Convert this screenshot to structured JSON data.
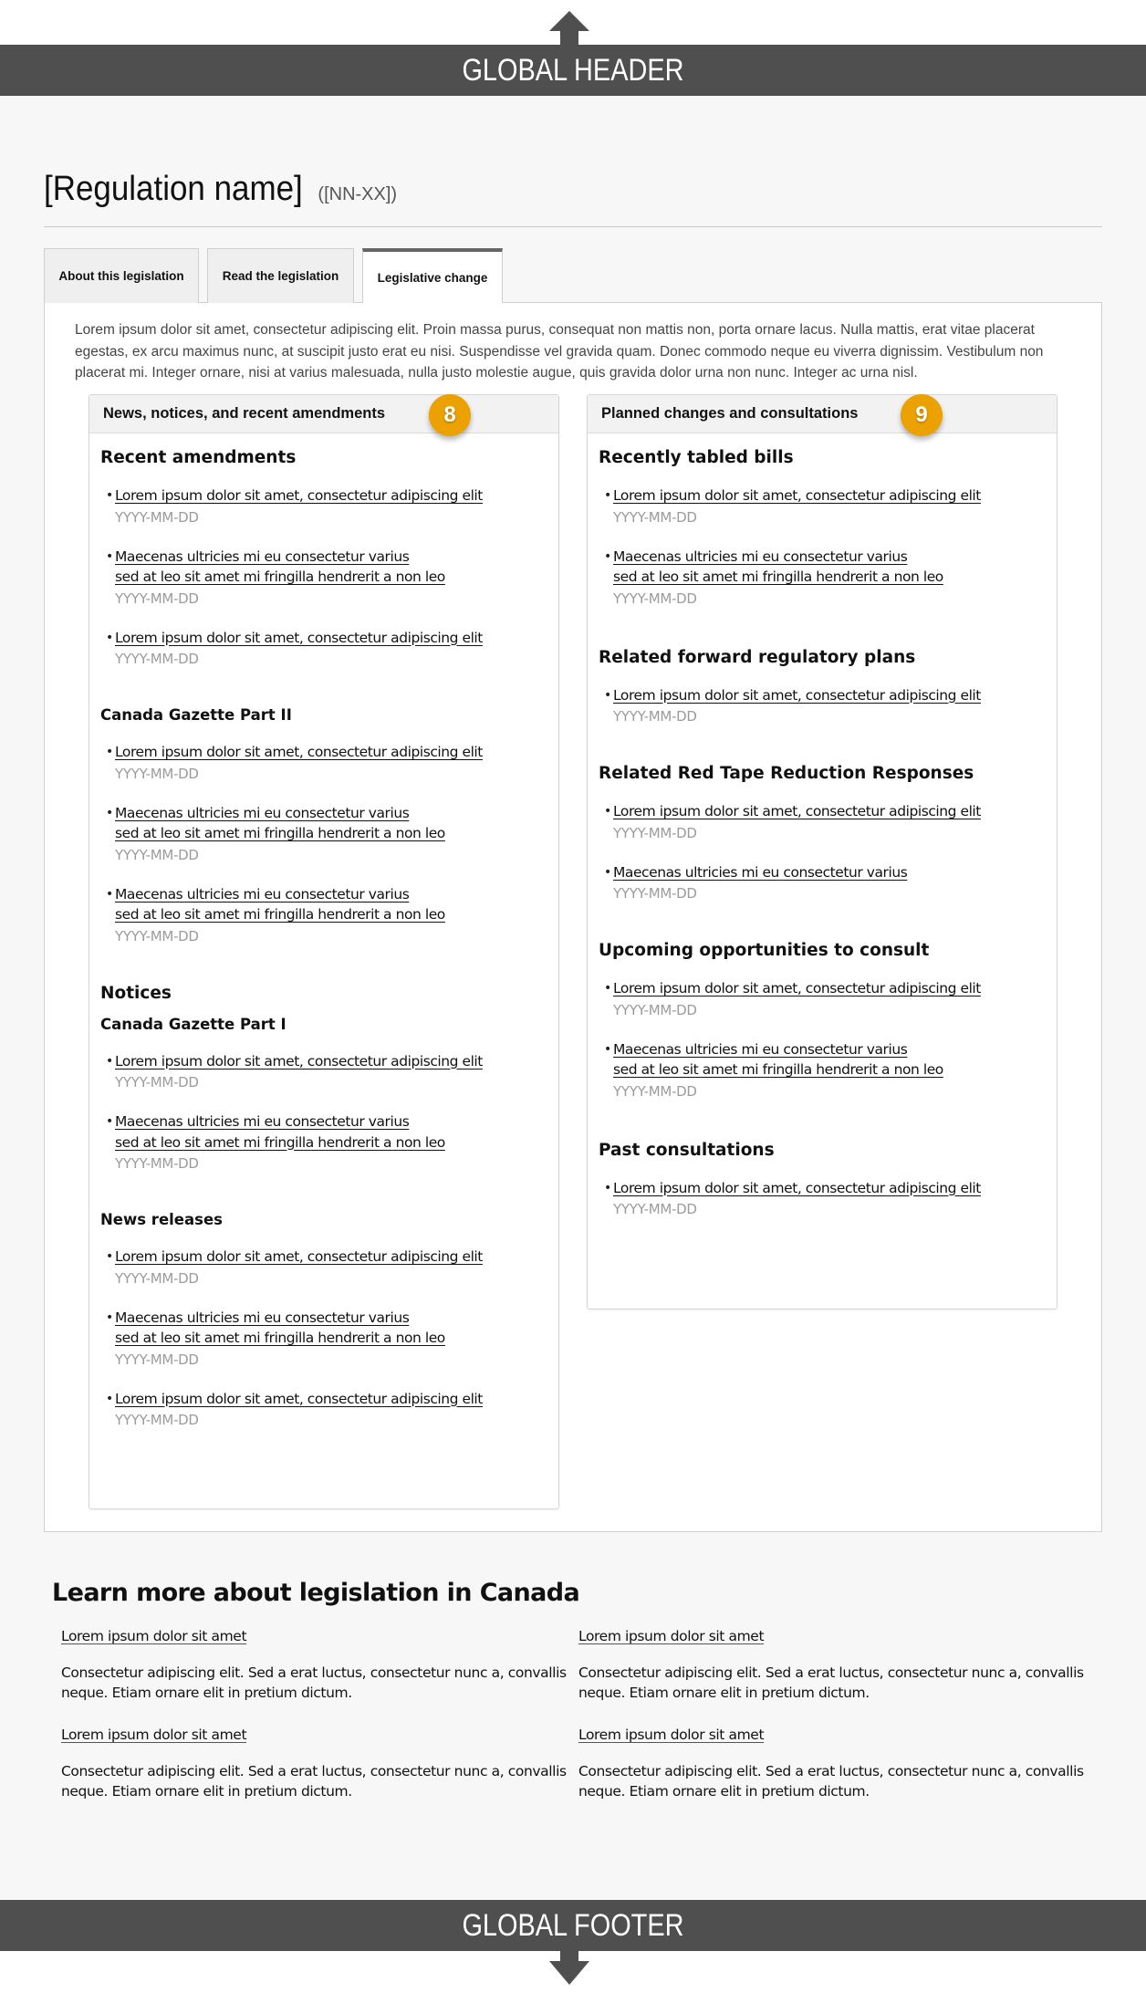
{
  "global_header": {
    "label": "GLOBAL HEADER",
    "arrow": "arrow-up-icon"
  },
  "global_footer": {
    "label": "GLOBAL FOOTER",
    "arrow": "arrow-down-icon"
  },
  "page": {
    "title": "[Regulation name]",
    "code": "([NN-XX])"
  },
  "tabs": [
    {
      "label": "About this legislation",
      "active": false
    },
    {
      "label": "Read the legislation",
      "active": false
    },
    {
      "label": "Legislative change",
      "active": true
    }
  ],
  "intro": "Lorem ipsum dolor sit amet, consectetur adipiscing elit. Proin massa purus, consequat non mattis non, porta ornare lacus. Nulla mattis, erat vitae placerat egestas, ex arcu maximus nunc, at suscipit justo erat eu nisi. Suspendisse vel gravida quam. Donec commodo neque eu viverra dignissim. Vestibulum non placerat mi. Integer ornare, nisi at varius malesuada, nulla justo molestie augue, quis gravida dolor urna non nunc. Integer ac urna nisl.",
  "colors": {
    "badge": "#eba100",
    "bar": "#4f4f4f",
    "date": "#9b9b9b"
  },
  "left_card": {
    "title": "News, notices, and recent amendments",
    "badge": "8",
    "sections": [
      {
        "heading": "Recent amendments",
        "items": [
          {
            "lines": [
              "Lorem ipsum dolor sit amet, consectetur adipiscing elit"
            ],
            "date": "YYYY-MM-DD"
          },
          {
            "lines": [
              "Maecenas ultricies mi eu consectetur varius",
              "sed at leo sit amet mi fringilla hendrerit a non leo"
            ],
            "date": "YYYY-MM-DD"
          },
          {
            "lines": [
              "Lorem ipsum dolor sit amet, consectetur adipiscing elit"
            ],
            "date": "YYYY-MM-DD"
          }
        ]
      },
      {
        "heading": "Canada Gazette Part II",
        "items": [
          {
            "lines": [
              "Lorem ipsum dolor sit amet, consectetur adipiscing elit"
            ],
            "date": "YYYY-MM-DD"
          },
          {
            "lines": [
              "Maecenas ultricies mi eu consectetur varius",
              "sed at leo sit amet mi fringilla hendrerit a non leo"
            ],
            "date": "YYYY-MM-DD"
          },
          {
            "lines": [
              "Maecenas ultricies mi eu consectetur varius",
              "sed at leo sit amet mi fringilla hendrerit a non leo"
            ],
            "date": "YYYY-MM-DD"
          }
        ]
      },
      {
        "heading": "Notices",
        "items": []
      },
      {
        "heading": "Canada Gazette Part I",
        "items": [
          {
            "lines": [
              "Lorem ipsum dolor sit amet, consectetur adipiscing elit"
            ],
            "date": "YYYY-MM-DD"
          },
          {
            "lines": [
              "Maecenas ultricies mi eu consectetur varius",
              "sed at leo sit amet mi fringilla hendrerit a non leo"
            ],
            "date": "YYYY-MM-DD"
          }
        ]
      },
      {
        "heading": "News releases",
        "items": [
          {
            "lines": [
              "Lorem ipsum dolor sit amet, consectetur adipiscing elit"
            ],
            "date": "YYYY-MM-DD"
          },
          {
            "lines": [
              "Maecenas ultricies mi eu consectetur varius",
              "sed at leo sit amet mi fringilla hendrerit a non leo"
            ],
            "date": "YYYY-MM-DD"
          },
          {
            "lines": [
              "Lorem ipsum dolor sit amet, consectetur adipiscing elit"
            ],
            "date": "YYYY-MM-DD"
          }
        ]
      }
    ]
  },
  "right_card": {
    "title": "Planned changes and consultations",
    "badge": "9",
    "sections": [
      {
        "heading": "Recently tabled bills",
        "items": [
          {
            "lines": [
              "Lorem ipsum dolor sit amet, consectetur adipiscing elit"
            ],
            "date": "YYYY-MM-DD"
          },
          {
            "lines": [
              "Maecenas ultricies mi eu consectetur varius",
              "sed at leo sit amet mi fringilla hendrerit a non leo"
            ],
            "date": "YYYY-MM-DD"
          }
        ]
      },
      {
        "heading": "Related forward regulatory plans",
        "items": [
          {
            "lines": [
              "Lorem ipsum dolor sit amet, consectetur adipiscing elit"
            ],
            "date": "YYYY-MM-DD"
          }
        ]
      },
      {
        "heading": "Related Red Tape Reduction Responses",
        "items": [
          {
            "lines": [
              "Lorem ipsum dolor sit amet, consectetur adipiscing elit"
            ],
            "date": "YYYY-MM-DD"
          },
          {
            "lines": [
              "Maecenas ultricies mi eu consectetur varius"
            ],
            "date": "YYYY-MM-DD"
          }
        ]
      },
      {
        "heading": "Upcoming opportunities to consult",
        "items": [
          {
            "lines": [
              "Lorem ipsum dolor sit amet, consectetur adipiscing elit"
            ],
            "date": "YYYY-MM-DD"
          },
          {
            "lines": [
              "Maecenas ultricies mi eu consectetur varius",
              "sed at leo sit amet mi fringilla hendrerit a non leo"
            ],
            "date": "YYYY-MM-DD"
          }
        ]
      },
      {
        "heading": "Past consultations",
        "items": [
          {
            "lines": [
              "Lorem ipsum dolor sit amet, consectetur adipiscing elit"
            ],
            "date": "YYYY-MM-DD"
          }
        ]
      }
    ]
  },
  "learn_more": {
    "title": "Learn more about legislation in Canada",
    "items": [
      {
        "link": "Lorem ipsum dolor sit amet",
        "text": "Consectetur adipiscing elit. Sed a erat luctus, consectetur nunc a, convallis neque. Etiam ornare elit in pretium dictum."
      },
      {
        "link": "Lorem ipsum dolor sit amet",
        "text": "Consectetur adipiscing elit. Sed a erat luctus, consectetur nunc a, convallis neque. Etiam ornare elit in pretium dictum."
      },
      {
        "link": "Lorem ipsum dolor sit amet",
        "text": "Consectetur adipiscing elit. Sed a erat luctus, consectetur nunc a, convallis neque. Etiam ornare elit in pretium dictum."
      },
      {
        "link": "Lorem ipsum dolor sit amet",
        "text": "Consectetur adipiscing elit. Sed a erat luctus, consectetur nunc a, convallis neque. Etiam ornare elit in pretium dictum."
      }
    ]
  }
}
